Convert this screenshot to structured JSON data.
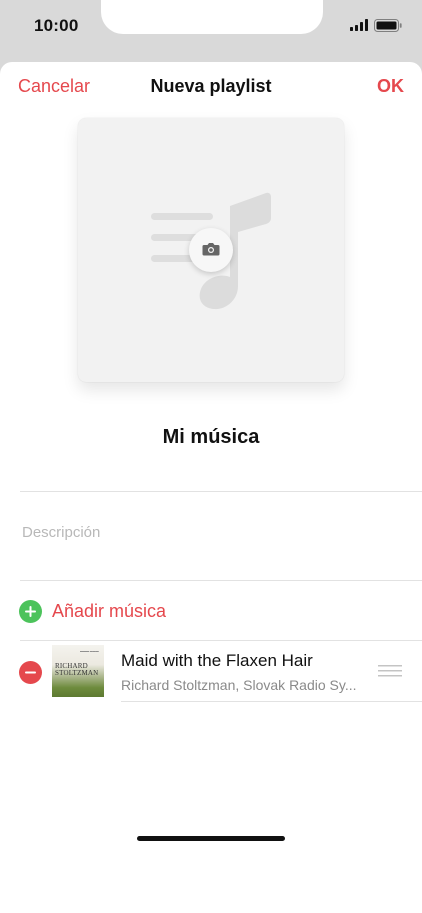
{
  "status_bar": {
    "time": "10:00"
  },
  "nav": {
    "cancel_label": "Cancelar",
    "title": "Nueva playlist",
    "ok_label": "OK"
  },
  "playlist": {
    "name": "Mi música",
    "description_placeholder": "Descripción"
  },
  "actions": {
    "add_music_label": "Añadir música"
  },
  "tracks": [
    {
      "title": "Maid with the Flaxen Hair",
      "artist": "Richard Stoltzman, Slovak Radio Sy...",
      "album_art_text": "RICHARD STOLTZMAN"
    }
  ],
  "colors": {
    "accent": "#e5484d",
    "add_green": "#4cc35b",
    "remove_red": "#e5484d"
  },
  "icons": [
    "signal-icon",
    "battery-icon",
    "music-note-icon",
    "camera-icon",
    "add-icon",
    "remove-icon",
    "reorder-handle-icon"
  ]
}
